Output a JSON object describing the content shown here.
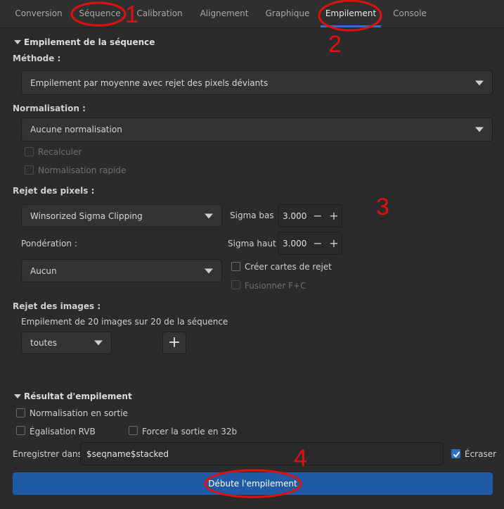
{
  "tabs": [
    {
      "label": "Conversion"
    },
    {
      "label": "Séquence"
    },
    {
      "label": "Calibration"
    },
    {
      "label": "Alignement"
    },
    {
      "label": "Graphique"
    },
    {
      "label": "Empilement"
    },
    {
      "label": "Console"
    }
  ],
  "stacking": {
    "section_title": "Empilement de la séquence",
    "method_label": "Méthode :",
    "method_value": "Empilement par moyenne avec rejet des pixels déviants",
    "normalisation_label": "Normalisation :",
    "normalisation_value": "Aucune normalisation",
    "recompute_label": "Recalculer",
    "fast_normalisation_label": "Normalisation rapide",
    "pixel_rejection_label": "Rejet des pixels :",
    "rejection_value": "Winsorized Sigma Clipping",
    "sigma_low_label": "Sigma bas :",
    "sigma_low_value": "3.000",
    "sigma_high_label": "Sigma haut :",
    "sigma_high_value": "3.000",
    "weighting_label": "Pondération :",
    "weighting_value": "Aucun",
    "rejection_maps_label": "Créer cartes de rejet",
    "merge_label": "Fusionner F+C",
    "image_rejection_label": "Rejet des images :",
    "image_rejection_info": "Empilement de 20 images sur 20 de la séquence",
    "image_filter_value": "toutes",
    "plus_glyph": "+",
    "minus_glyph": "−"
  },
  "result": {
    "section_title": "Résultat d'empilement",
    "output_normalisation_label": "Normalisation en sortie",
    "rgb_equalisation_label": "Égalisation RVB",
    "force_32b_label": "Forcer la sortie en 32b",
    "save_in_label": "Enregistrer dans :",
    "save_in_value": "$seqname$stacked",
    "overwrite_label": "Écraser",
    "overwrite_checked": true
  },
  "start_button_label": "Débute l'empilement",
  "annotations": [
    "1",
    "2",
    "3",
    "4"
  ],
  "colors": {
    "accent": "#2f6fc6",
    "start_button": "#1f5aa6",
    "annotation": "#e01010"
  }
}
